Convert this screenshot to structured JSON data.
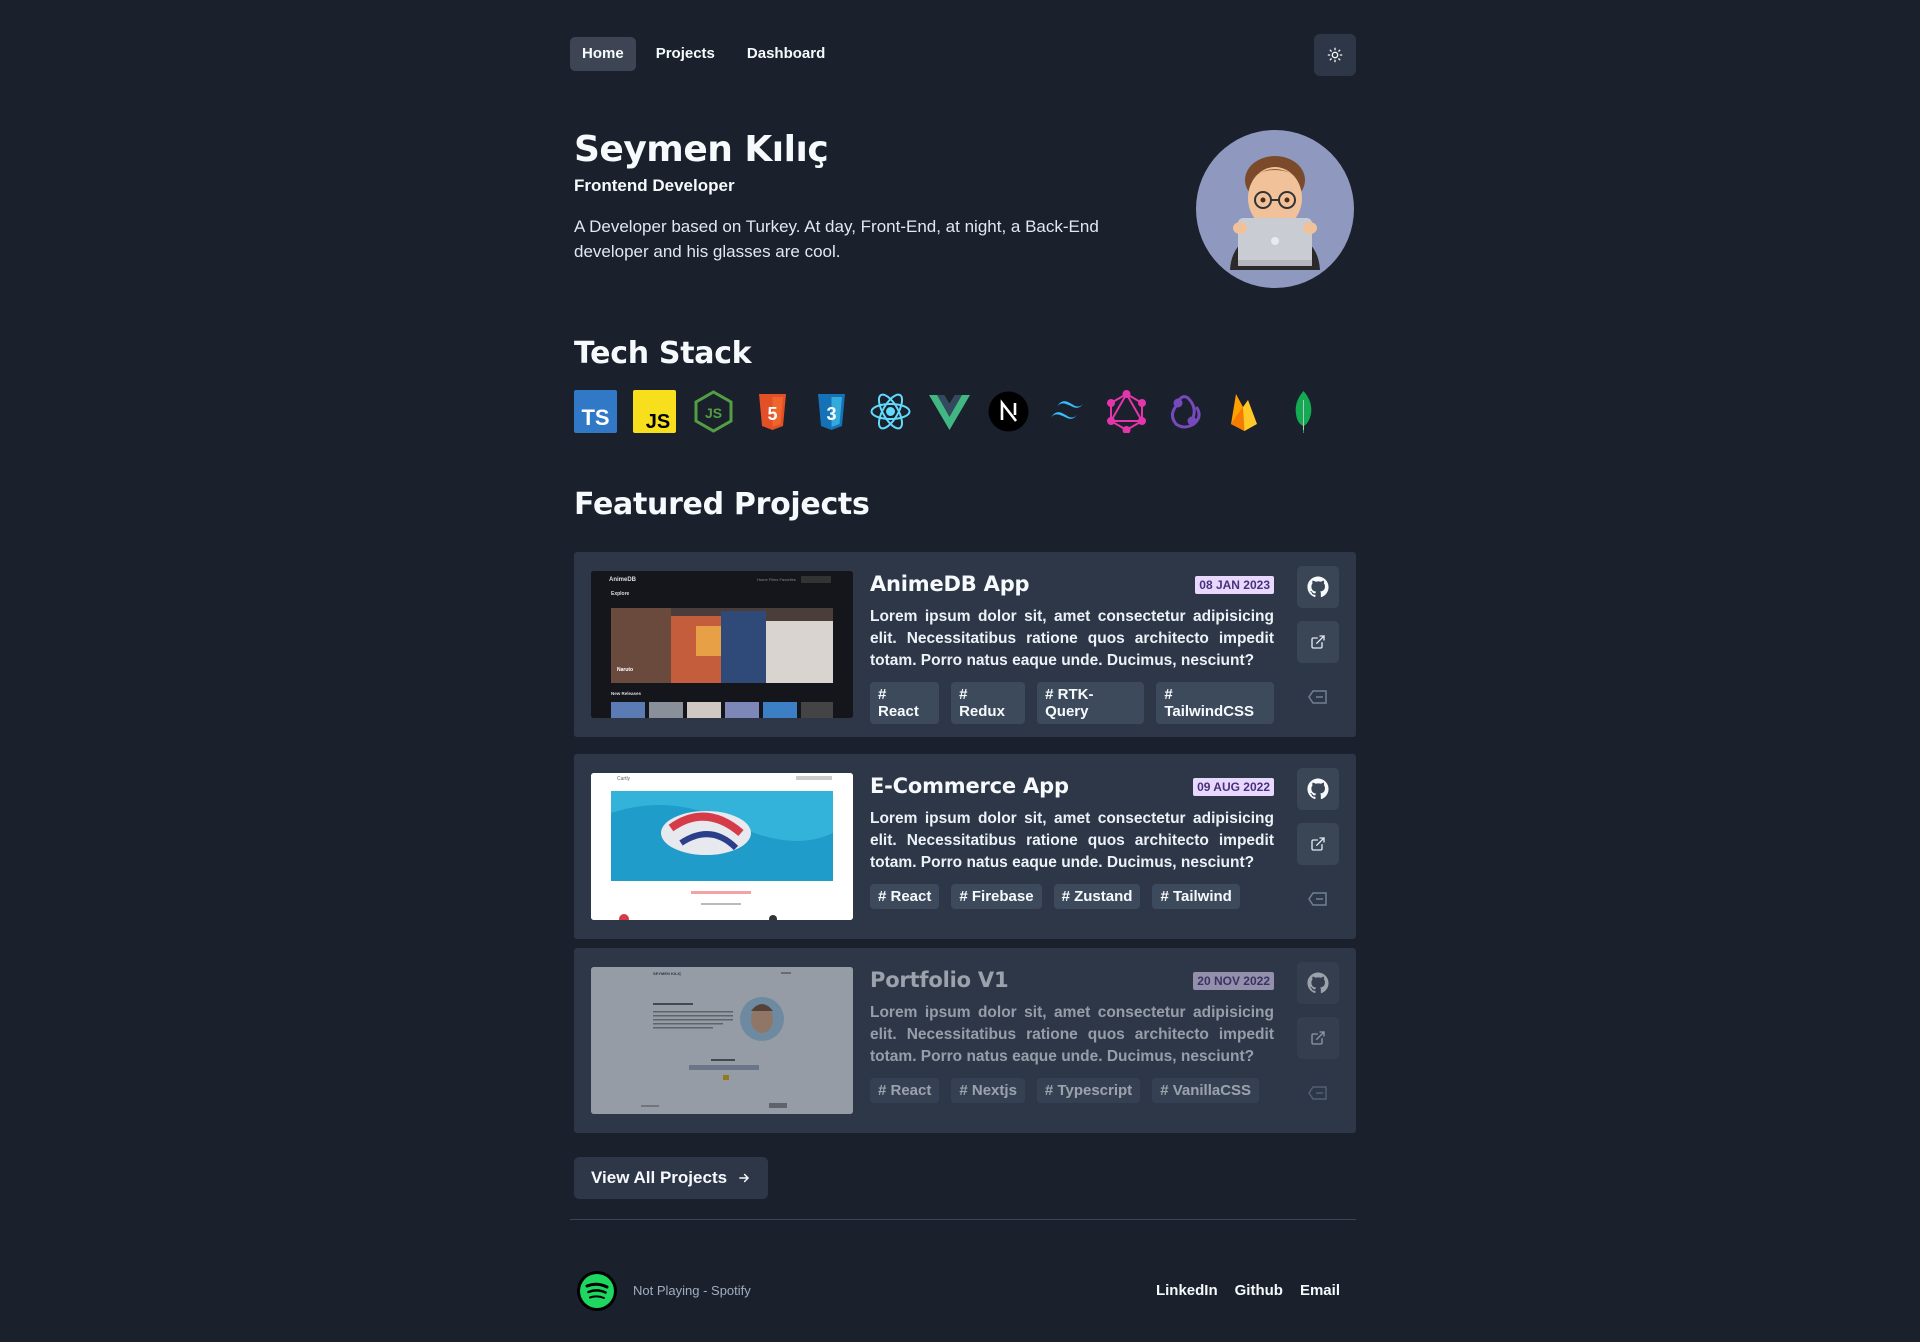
{
  "nav": {
    "links": [
      {
        "label": "Home",
        "active": true
      },
      {
        "label": "Projects",
        "active": false
      },
      {
        "label": "Dashboard",
        "active": false
      }
    ],
    "theme_toggle_icon": "sun-icon"
  },
  "hero": {
    "name": "Seymen Kılıç",
    "role": "Frontend Developer",
    "bio": "A Developer based on Turkey. At day, Front-End, at night, a Back-End developer and his glasses are cool.",
    "avatar_icon": "memoji-avatar-with-laptop"
  },
  "tech_stack": {
    "title": "Tech Stack",
    "icons": [
      "typescript-icon",
      "javascript-icon",
      "nodejs-icon",
      "html5-icon",
      "css3-icon",
      "react-icon",
      "vue-icon",
      "nextjs-icon",
      "tailwindcss-icon",
      "graphql-icon",
      "redux-icon",
      "firebase-icon",
      "mongodb-icon"
    ]
  },
  "projects": {
    "title": "Featured Projects",
    "items": [
      {
        "title": "AnimeDB App",
        "date": "08 JAN 2023",
        "description": "Lorem ipsum dolor sit, amet consectetur adipisicing elit. Necessitatibus ratione quos architecto impedit totam. Porro natus eaque unde. Ducimus, nesciunt?",
        "tags": [
          "# React",
          "# Redux",
          "# RTK-Query",
          "# TailwindCSS"
        ],
        "thumb": {
          "brand": "AnimeDB",
          "heading": "Explore",
          "caption": "Naruto",
          "section": "New Releases",
          "nav": "Home  Films  Favorites"
        }
      },
      {
        "title": "E-Commerce App",
        "date": "09 AUG 2022",
        "description": "Lorem ipsum dolor sit, amet consectetur adipisicing elit. Necessitatibus ratione quos architecto impedit totam. Porro natus eaque unde. Ducimus, nesciunt?",
        "tags": [
          "# React",
          "# Firebase",
          "# Zustand",
          "# Tailwind"
        ],
        "thumb": {
          "brand": "Cartly"
        }
      },
      {
        "title": "Portfolio V1",
        "date": "20 NOV 2022",
        "description": "Lorem ipsum dolor sit, amet consectetur adipisicing elit. Necessitatibus ratione quos architecto impedit totam. Porro natus eaque unde. Ducimus, nesciunt?",
        "tags": [
          "# React",
          "# Nextjs",
          "# Typescript",
          "# VanillaCSS"
        ],
        "thumb": {
          "brand": "SEYMEN KILIÇ"
        }
      }
    ],
    "action_icons": [
      "github-icon",
      "external-link-icon",
      "tag-icon"
    ],
    "view_all_label": "View All Projects"
  },
  "footer": {
    "now_playing": "Not Playing - Spotify",
    "links": [
      "LinkedIn",
      "Github",
      "Email"
    ]
  },
  "colors": {
    "background": "#1a202c",
    "card": "#2d3748",
    "date_badge_bg": "#e9d8fd",
    "date_badge_text": "#44337a",
    "spotify_green": "#1ed760"
  }
}
